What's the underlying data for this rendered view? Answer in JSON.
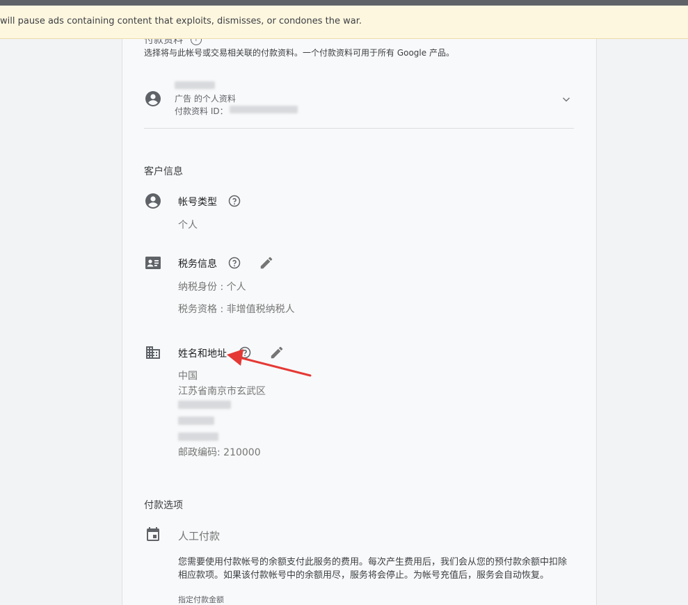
{
  "banner": {
    "text": "will pause ads containing content that exploits, dismisses, or condones the war."
  },
  "payment_profile": {
    "title_partial": "付款资料",
    "help_glyph": "?",
    "subtitle": "选择将与此帐号或交易相关联的付款资料。一个付款资料可用于所有 Google 产品。",
    "profile_type": "广告 的个人资料",
    "profile_id_label": "付款资料 ID："
  },
  "customer_info": {
    "title": "客户信息",
    "account_type": {
      "label": "帐号类型",
      "value": "个人"
    },
    "tax_info": {
      "label": "税务信息",
      "tax_identity": "纳税身份 : 个人",
      "tax_status": "税务资格 : 非增值税纳税人"
    },
    "name_address": {
      "label": "姓名和地址",
      "country": "中国",
      "region": "江苏省南京市玄武区",
      "postal_code": "邮政编码: 210000"
    }
  },
  "payment_options": {
    "title": "付款选项",
    "method": "人工付款",
    "description": "您需要使用付款帐号的余额支付此服务的费用。每次产生费用后，我们会从您的预付款余额中扣除相应款项。如果该付款帐号中的余额用尽，服务将会停止。为帐号充值后，服务会自动恢复。",
    "amount_label": "指定付款金额"
  },
  "icons": {
    "profile": "account-circle-icon",
    "chevron": "chevron-down-icon",
    "help": "help-circle-icon",
    "tax": "id-card-icon",
    "edit": "pencil-icon",
    "building": "building-icon",
    "calendar": "calendar-icon",
    "arrow": "red-annotation-arrow"
  },
  "colors": {
    "banner_bg": "#fef7e0",
    "arrow": "#e53935",
    "icon": "#5f6368"
  }
}
